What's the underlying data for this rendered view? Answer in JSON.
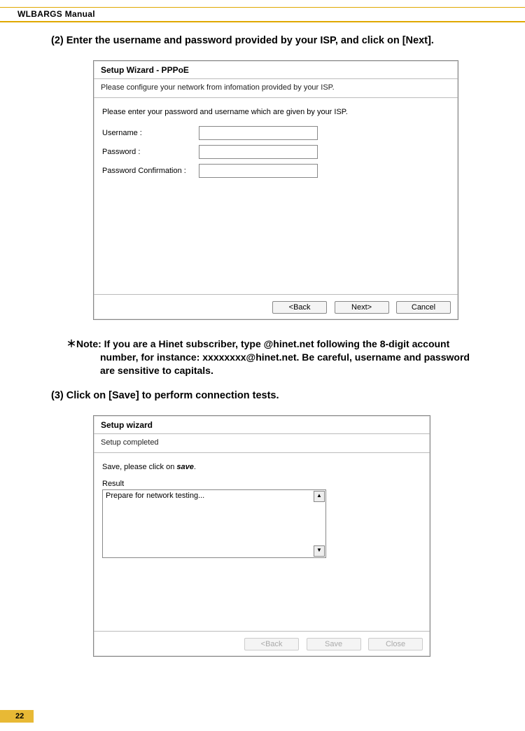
{
  "header": {
    "title": "WLBARGS Manual"
  },
  "step2": {
    "text": "(2) Enter the username and password provided by your ISP, and click on [Next]."
  },
  "dialog1": {
    "title": "Setup Wizard - PPPoE",
    "sub": "Please configure your network from infomation provided by your ISP.",
    "intro": "Please enter your password and username which are given by your ISP.",
    "fields": {
      "username_label": "Username :",
      "password_label": "Password :",
      "confirm_label": "Password Confirmation :"
    },
    "buttons": {
      "back": "<Back",
      "next": "Next>",
      "cancel": "Cancel"
    }
  },
  "note": {
    "prefix": "＊Note: If you are a Hinet subscriber, type @hinet.net following the 8-digit account",
    "line2": "number, for instance: xxxxxxxx@hinet.net. Be careful, username and password",
    "line3": "are sensitive to capitals."
  },
  "step3": {
    "text": "(3) Click on [Save] to perform connection tests."
  },
  "dialog2": {
    "title": "Setup wizard",
    "sub": "Setup completed",
    "save_prefix": "Save, please click on ",
    "save_word": "save",
    "save_suffix": ".",
    "result_label": "Result",
    "result_text": "Prepare for network testing...",
    "buttons": {
      "back": "<Back",
      "save": "Save",
      "close": "Close"
    }
  },
  "page_number": "22"
}
